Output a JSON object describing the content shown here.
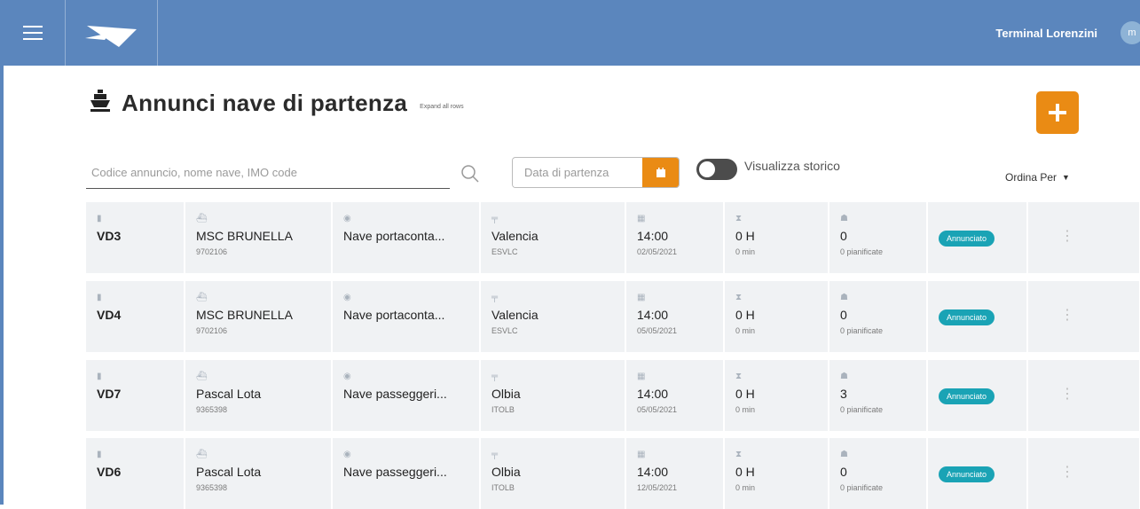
{
  "header": {
    "user_name": "Terminal Lorenzini",
    "avatar_initials": "m",
    "colors": {
      "bar": "#5b86bd",
      "accent": "#ea8b14",
      "badge": "#1aa3b5"
    },
    "icons": [
      "menu-icon",
      "logo-icon"
    ]
  },
  "page": {
    "title": "Annunci nave di partenza",
    "subtitle": "Expand all rows",
    "title_icon": "ship-icon",
    "add_button_icon": "plus-icon"
  },
  "filters": {
    "search_placeholder": "Codice annuncio, nome nave, IMO code",
    "search_value": "",
    "date_placeholder": "Data di partenza",
    "history_toggle_label": "Visualizza storico",
    "history_toggle_on": false,
    "sort_label": "Ordina Per"
  },
  "rows": [
    {
      "code": "VD3",
      "ship": "MSC BRUNELLA",
      "imo": "9702106",
      "type": "Nave portaconta...",
      "port": "Valencia",
      "port_code": "ESVLC",
      "time": "14:00",
      "date": "02/05/2021",
      "hours": "0 H",
      "minutes": "0 min",
      "count": "0",
      "planned": "0 pianificate",
      "status": "Annunciato"
    },
    {
      "code": "VD4",
      "ship": "MSC BRUNELLA",
      "imo": "9702106",
      "type": "Nave portaconta...",
      "port": "Valencia",
      "port_code": "ESVLC",
      "time": "14:00",
      "date": "05/05/2021",
      "hours": "0 H",
      "minutes": "0 min",
      "count": "0",
      "planned": "0 pianificate",
      "status": "Annunciato"
    },
    {
      "code": "VD7",
      "ship": "Pascal Lota",
      "imo": "9365398",
      "type": "Nave passeggeri...",
      "port": "Olbia",
      "port_code": "ITOLB",
      "time": "14:00",
      "date": "05/05/2021",
      "hours": "0 H",
      "minutes": "0 min",
      "count": "3",
      "planned": "0 pianificate",
      "status": "Annunciato"
    },
    {
      "code": "VD6",
      "ship": "Pascal Lota",
      "imo": "9365398",
      "type": "Nave passeggeri...",
      "port": "Olbia",
      "port_code": "ITOLB",
      "time": "14:00",
      "date": "12/05/2021",
      "hours": "0 H",
      "minutes": "0 min",
      "count": "0",
      "planned": "0 pianificate",
      "status": "Annunciato"
    }
  ]
}
